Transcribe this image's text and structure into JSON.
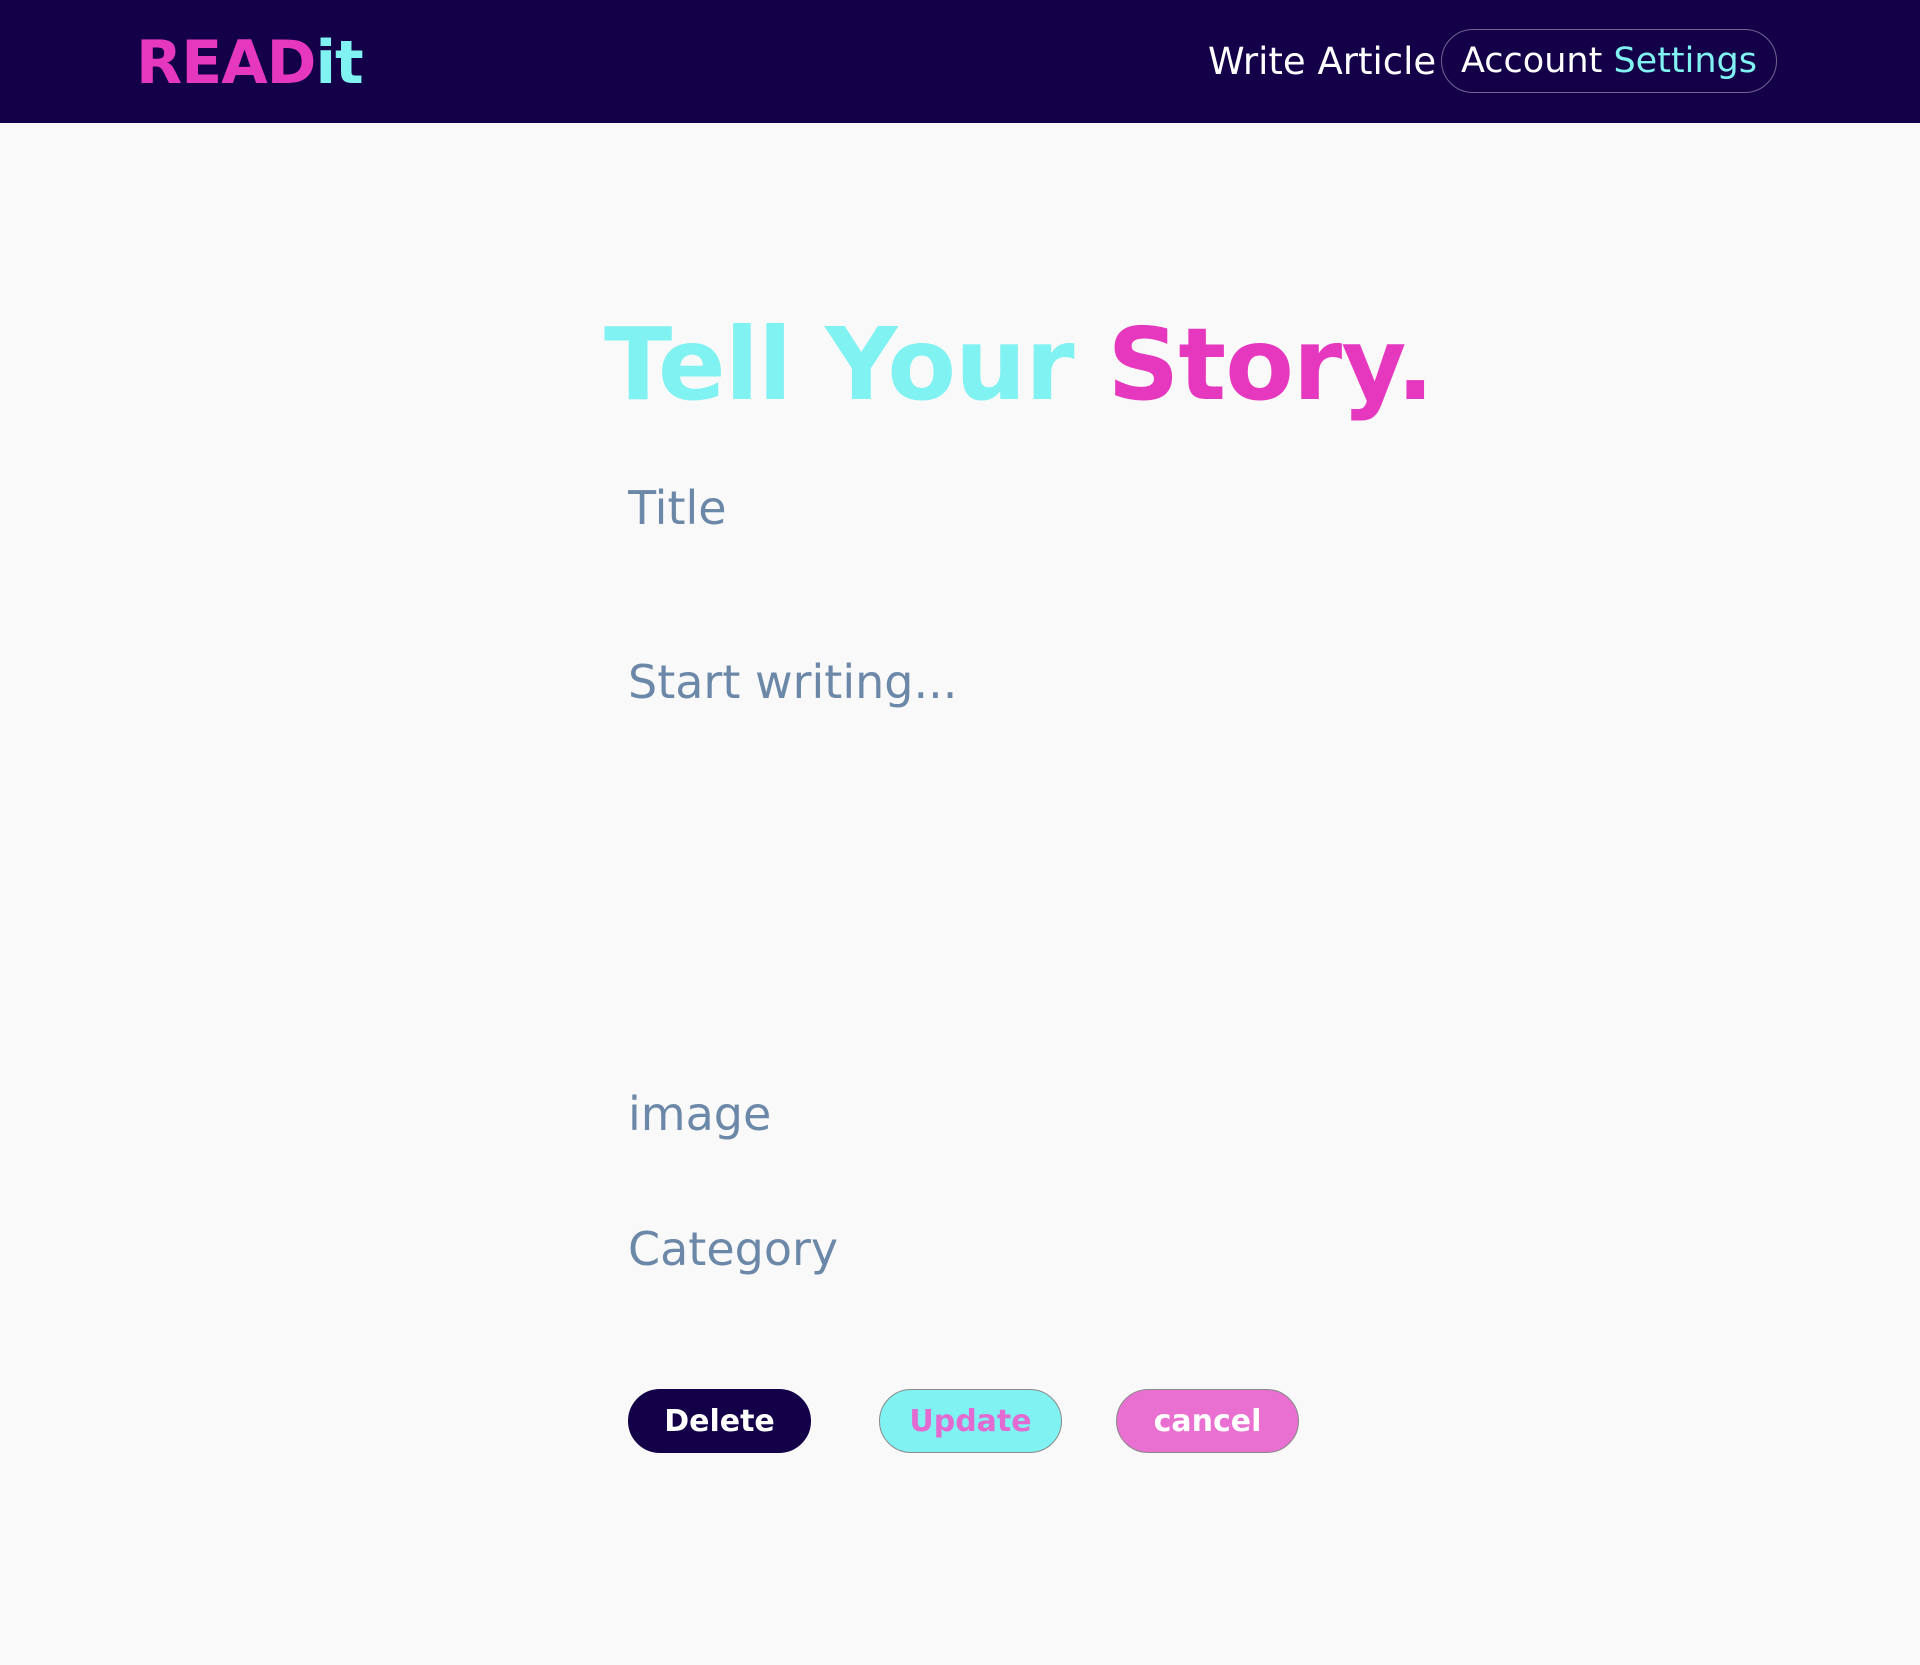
{
  "brand": {
    "part1": "READ",
    "part2": "it"
  },
  "nav": {
    "write_article": "Write Article",
    "account_word": "Account",
    "settings_word": "Settings"
  },
  "headline": {
    "part1": "Tell Your",
    "part2": "Story."
  },
  "form": {
    "title_placeholder": "Title",
    "title_value": "",
    "body_placeholder": "Start writing...",
    "body_value": "",
    "image_placeholder": "image",
    "image_value": "",
    "category_placeholder": "Category",
    "category_value": ""
  },
  "buttons": {
    "delete": "Delete",
    "update": "Update",
    "cancel": "cancel"
  },
  "colors": {
    "navbar_bg": "#130048",
    "brand_pink": "#e637bf",
    "brand_cyan": "#7ff2f1",
    "placeholder": "#6c88a8",
    "page_bg": "#f9f9f9",
    "cancel_bg": "#e96fd0"
  }
}
